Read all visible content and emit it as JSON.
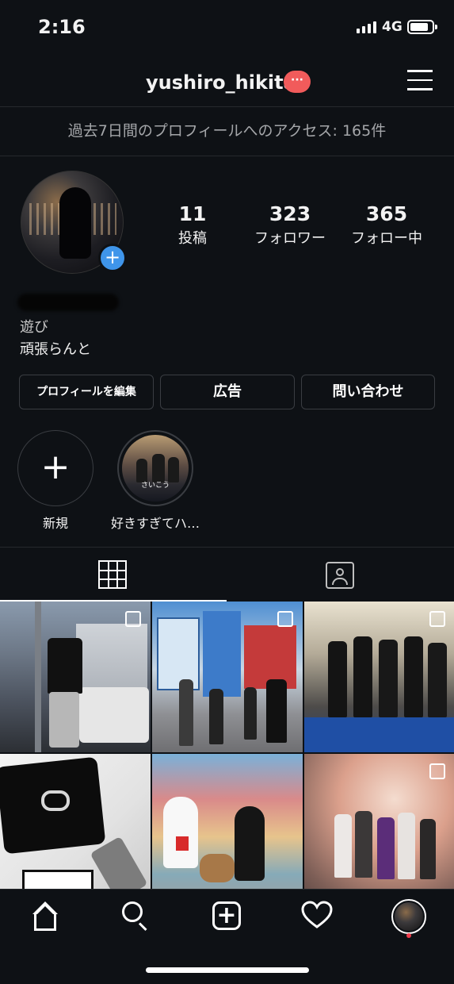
{
  "status_bar": {
    "time": "2:16",
    "network": "4G"
  },
  "header": {
    "username": "yushiro_hikita",
    "dm_badge": "···"
  },
  "access_banner": "過去7日間のプロフィールへのアクセス: 165件",
  "stats": [
    {
      "value": "11",
      "label": "投稿"
    },
    {
      "value": "323",
      "label": "フォロワー"
    },
    {
      "value": "365",
      "label": "フォロー中"
    }
  ],
  "bio": {
    "line1": "遊び",
    "line2": "頑張らんと"
  },
  "buttons": {
    "edit_profile": "プロフィールを編集",
    "ads": "広告",
    "contact": "問い合わせ"
  },
  "highlights": [
    {
      "label": "新規",
      "icon": "plus-icon"
    },
    {
      "label": "好きすぎてハ…",
      "caption": "さいこう"
    }
  ],
  "tabs": {
    "grid": "grid-icon",
    "tagged": "tagged-person-icon"
  },
  "grid_posts": [
    {
      "desc": "street",
      "multi": true
    },
    {
      "desc": "dotonbori",
      "multi": true
    },
    {
      "desc": "ceremony",
      "multi": true
    },
    {
      "desc": "wallet",
      "multi": false
    },
    {
      "desc": "mural",
      "multi": false
    },
    {
      "desc": "group",
      "multi": true
    }
  ],
  "bottom_nav": [
    "home-icon",
    "search-icon",
    "add-post-icon",
    "heart-icon",
    "profile-avatar"
  ]
}
